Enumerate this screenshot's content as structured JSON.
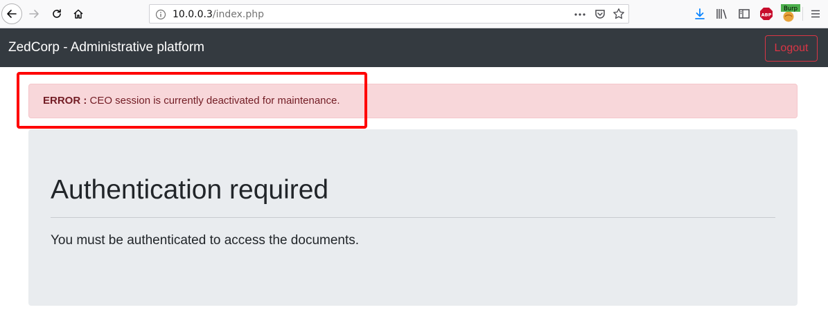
{
  "browser": {
    "url_host": "10.0.0.3",
    "url_path": "/index.php",
    "burp_label": "Burp",
    "abp_label": "ABP"
  },
  "navbar": {
    "brand": "ZedCorp - Administrative platform",
    "logout_label": "Logout"
  },
  "alert": {
    "prefix": "ERROR :",
    "message": " CEO session is currently deactivated for maintenance."
  },
  "jumbotron": {
    "title": "Authentication required",
    "lead": "You must be authenticated to access the documents."
  },
  "colors": {
    "navbar_bg": "#343a40",
    "danger": "#dc3545",
    "alert_bg": "#f8d7da",
    "alert_text": "#721c24",
    "jumbotron_bg": "#e9ecef",
    "highlight": "#ff0000"
  }
}
